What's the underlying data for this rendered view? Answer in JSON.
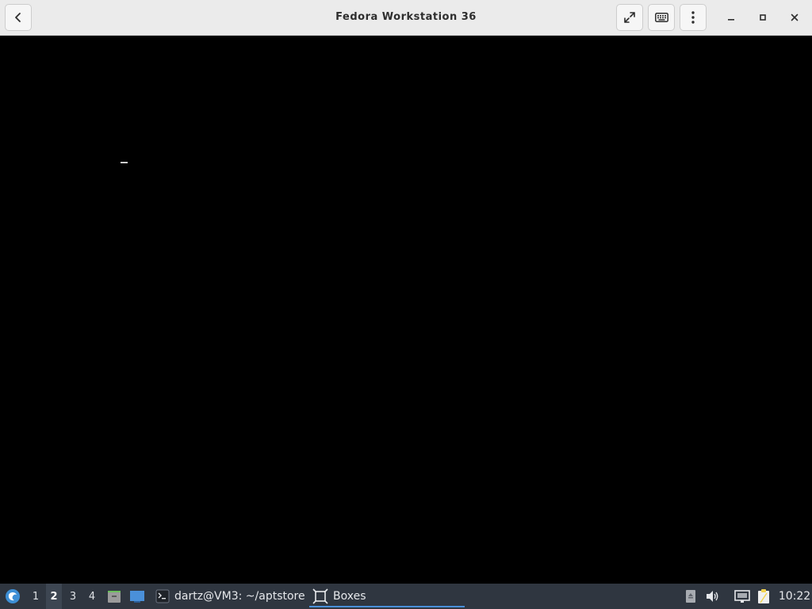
{
  "window": {
    "title": "Fedora Workstation 36",
    "buttons": {
      "back_icon": "chevron-left-icon",
      "fullscreen_icon": "fullscreen-icon",
      "keyboard_icon": "keyboard-icon",
      "menu_icon": "vertical-dots-icon"
    },
    "controls": [
      "minimize",
      "maximize",
      "close"
    ]
  },
  "vm_display": {
    "background": "#000000",
    "text_cursor": "_"
  },
  "taskbar": {
    "start_icon": "start-menu-logo-icon",
    "workspaces": [
      "1",
      "2",
      "3",
      "4"
    ],
    "active_workspace": "2",
    "launchers": [
      {
        "name": "files",
        "icon": "file-manager-icon"
      },
      {
        "name": "show-desktop",
        "icon": "desktop-icon"
      }
    ],
    "tasks": [
      {
        "label": "dartz@VM3: ~/aptstore",
        "icon": "terminal-icon",
        "active": false
      },
      {
        "label": "Boxes",
        "icon": "boxes-icon",
        "active": true
      }
    ],
    "tray": [
      "usb-drive-icon",
      "volume-icon",
      "network-icon",
      "clipboard-icon"
    ],
    "clock": "10:22"
  },
  "colors": {
    "headerbar": "#ebebeb",
    "taskbar": "#2f3640",
    "accent": "#4a90d9"
  }
}
